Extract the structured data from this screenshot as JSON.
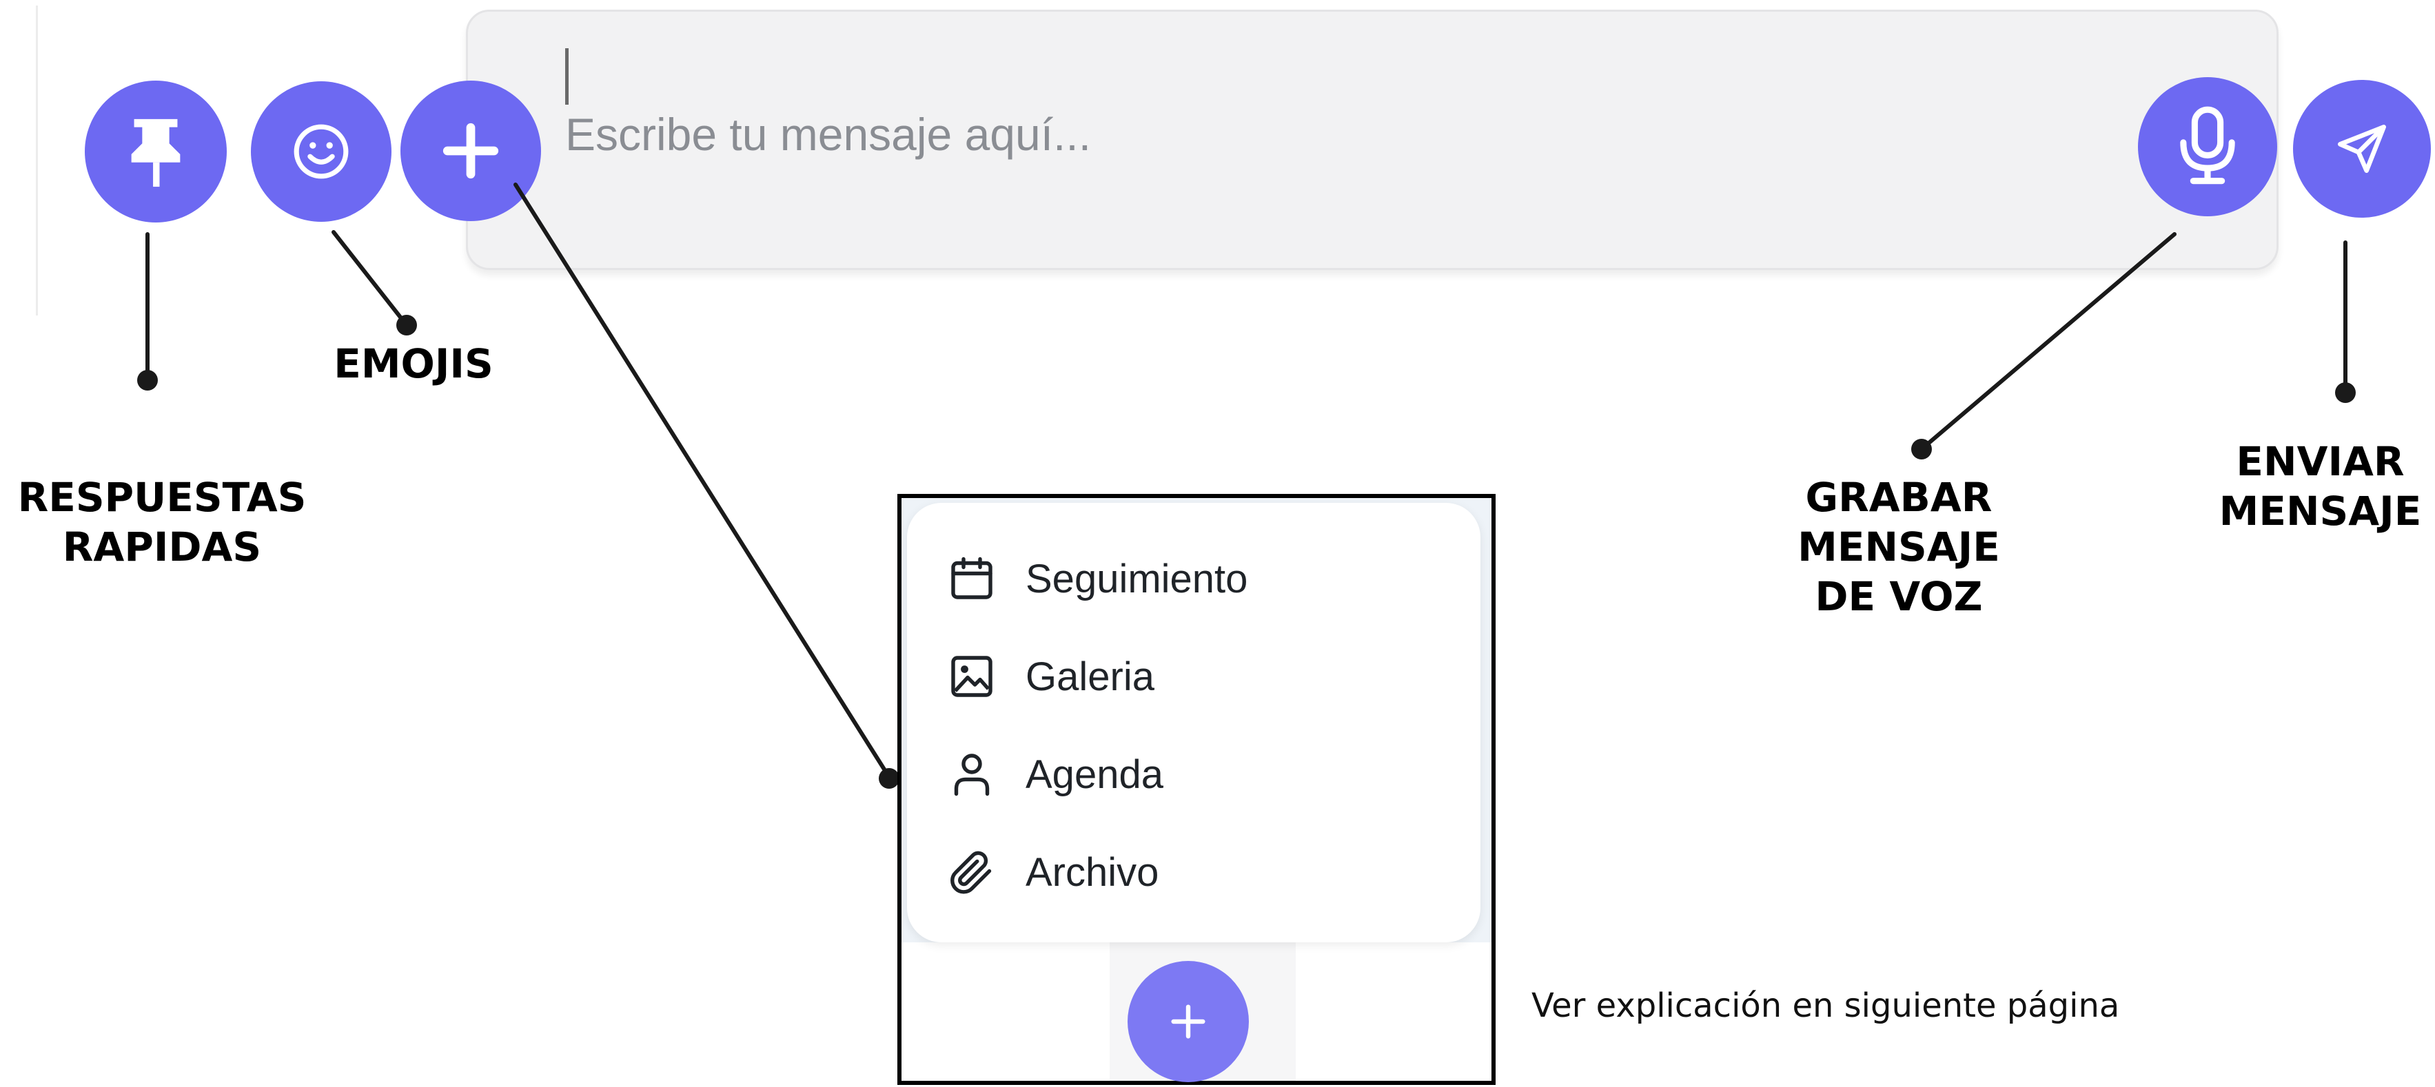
{
  "composer": {
    "placeholder": "Escribe tu mensaje aquí..."
  },
  "buttons": {
    "pin": "pin-icon",
    "emoji": "smiley-icon",
    "add": "plus-icon",
    "mic": "microphone-icon",
    "send": "paper-plane-icon",
    "accent_color": "#6d69f2"
  },
  "callouts": {
    "quick_replies": [
      "RESPUESTAS",
      "RAPIDAS"
    ],
    "emojis": "EMOJIS",
    "voice": [
      "GRABAR",
      "MENSAJE",
      "DE VOZ"
    ],
    "send": [
      "ENVIAR",
      "MENSAJE"
    ]
  },
  "attach_menu": {
    "items": [
      {
        "label": "Seguimiento",
        "icon": "calendar-icon"
      },
      {
        "label": "Galeria",
        "icon": "image-icon"
      },
      {
        "label": "Agenda",
        "icon": "user-icon"
      },
      {
        "label": "Archivo",
        "icon": "paperclip-icon"
      }
    ],
    "toggle_icon": "plus-icon"
  },
  "footnote": "Ver explicación en siguiente página"
}
